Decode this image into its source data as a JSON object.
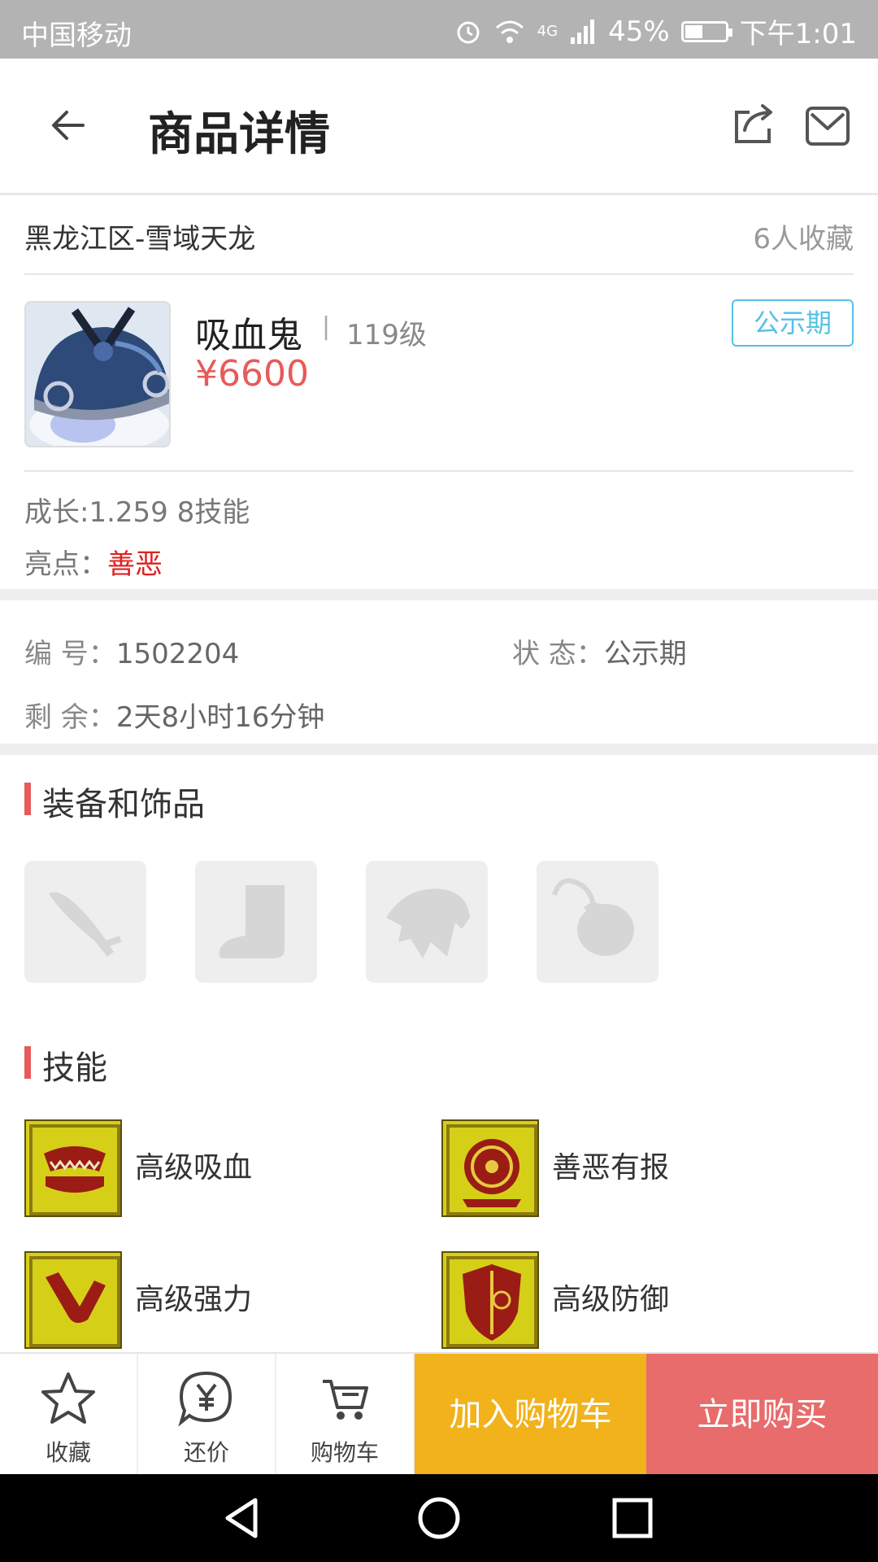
{
  "status_bar": {
    "carrier": "中国移动",
    "network": "4G",
    "battery_percent": "45%",
    "battery_level": 0.45,
    "time": "下午1:01"
  },
  "nav": {
    "title": "商品详情",
    "back_icon": "arrow-left-icon",
    "share_icon": "share-icon",
    "mail_icon": "mail-icon"
  },
  "product": {
    "server": "黑龙江区-雪域天龙",
    "favorites": "6人收藏",
    "pet_name": "吸血鬼",
    "separator": "|",
    "level": "119级",
    "price": "¥6600",
    "status_tag": "公示期",
    "growth": "成长:1.259 8技能",
    "highlight_label": "亮点：",
    "highlight_value": "善恶"
  },
  "info": {
    "id_label": "编  号：",
    "id_value": "1502204",
    "state_label": "状  态：",
    "state_value": "公示期",
    "remain_label": "剩  余：",
    "remain_value": "2天8小时16分钟"
  },
  "equipment": {
    "title": "装备和饰品",
    "slots": [
      "weapon-icon",
      "boot-icon",
      "armor-icon",
      "accessory-icon"
    ]
  },
  "skills": {
    "title": "技能",
    "items": [
      "高级吸血",
      "善恶有报",
      "高级强力",
      "高级防御"
    ]
  },
  "bottom_bar": {
    "favorite": "收藏",
    "bargain": "还价",
    "cart": "购物车",
    "add_to_cart": "加入购物车",
    "buy_now": "立即购买"
  },
  "colors": {
    "accent_red": "#e85a5a",
    "tag_blue": "#56c1e6",
    "cart_yellow": "#f1b21c",
    "buy_red": "#e86c6c"
  }
}
